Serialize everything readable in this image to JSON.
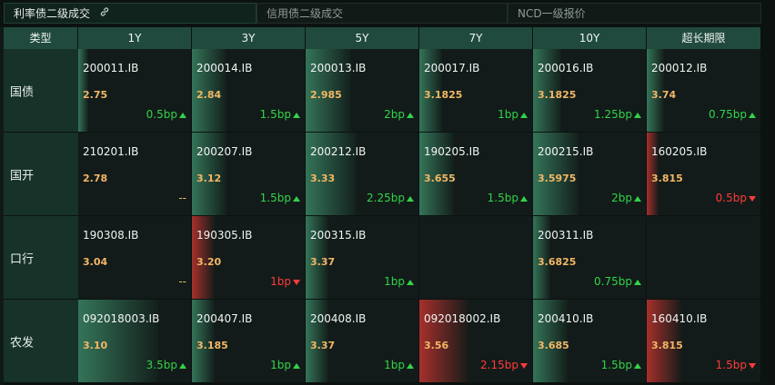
{
  "tabs": [
    {
      "label": "利率债二级成交",
      "active": true,
      "icon": "link-icon"
    },
    {
      "label": "信用债二级成交",
      "active": false
    },
    {
      "label": "NCD一级报价",
      "active": false
    }
  ],
  "table": {
    "columns": [
      "类型",
      "1Y",
      "3Y",
      "5Y",
      "7Y",
      "10Y",
      "超长期限"
    ],
    "rows": [
      {
        "label": "国债",
        "cells": [
          {
            "code": "200011.IB",
            "yield": "2.75",
            "change": "0.5bp",
            "dir": "up",
            "bar_level": 0.09
          },
          {
            "code": "200014.IB",
            "yield": "2.84",
            "change": "1.5bp",
            "dir": "up",
            "bar_level": 0.3
          },
          {
            "code": "200013.IB",
            "yield": "2.985",
            "change": "2bp",
            "dir": "up",
            "bar_level": 0.4
          },
          {
            "code": "200017.IB",
            "yield": "3.1825",
            "change": "1bp",
            "dir": "up",
            "bar_level": 0.2
          },
          {
            "code": "200016.IB",
            "yield": "3.1825",
            "change": "1.25bp",
            "dir": "up",
            "bar_level": 0.25
          },
          {
            "code": "200012.IB",
            "yield": "3.74",
            "change": "0.75bp",
            "dir": "up",
            "bar_level": 0.15
          }
        ]
      },
      {
        "label": "国开",
        "cells": [
          {
            "code": "210201.IB",
            "yield": "2.78",
            "change": "--",
            "dir": "flat",
            "bar_level": 0
          },
          {
            "code": "200207.IB",
            "yield": "3.12",
            "change": "1.5bp",
            "dir": "up",
            "bar_level": 0.3
          },
          {
            "code": "200212.IB",
            "yield": "3.33",
            "change": "2.25bp",
            "dir": "up",
            "bar_level": 0.45
          },
          {
            "code": "190205.IB",
            "yield": "3.655",
            "change": "1.5bp",
            "dir": "up",
            "bar_level": 0.3
          },
          {
            "code": "200215.IB",
            "yield": "3.5975",
            "change": "2bp",
            "dir": "up",
            "bar_level": 0.4
          },
          {
            "code": "160205.IB",
            "yield": "3.815",
            "change": "0.5bp",
            "dir": "down",
            "bar_level": 0.1
          }
        ]
      },
      {
        "label": "口行",
        "cells": [
          {
            "code": "190308.IB",
            "yield": "3.04",
            "change": "--",
            "dir": "flat",
            "bar_level": 0
          },
          {
            "code": "190305.IB",
            "yield": "3.20",
            "change": "1bp",
            "dir": "down",
            "bar_level": 0.2
          },
          {
            "code": "200315.IB",
            "yield": "3.37",
            "change": "1bp",
            "dir": "up",
            "bar_level": 0.2
          },
          {
            "code": "",
            "yield": "",
            "change": "",
            "dir": "none",
            "bar_level": 0
          },
          {
            "code": "200311.IB",
            "yield": "3.6825",
            "change": "0.75bp",
            "dir": "up",
            "bar_level": 0.15
          },
          {
            "code": "",
            "yield": "",
            "change": "",
            "dir": "none",
            "bar_level": 0
          }
        ]
      },
      {
        "label": "农发",
        "cells": [
          {
            "code": "092018003.IB",
            "yield": "3.10",
            "change": "3.5bp",
            "dir": "up",
            "bar_level": 0.7
          },
          {
            "code": "200407.IB",
            "yield": "3.185",
            "change": "1bp",
            "dir": "up",
            "bar_level": 0.2
          },
          {
            "code": "200408.IB",
            "yield": "3.37",
            "change": "1bp",
            "dir": "up",
            "bar_level": 0.2
          },
          {
            "code": "092018002.IB",
            "yield": "3.56",
            "change": "2.15bp",
            "dir": "down",
            "bar_level": 0.43
          },
          {
            "code": "200410.IB",
            "yield": "3.685",
            "change": "1.5bp",
            "dir": "up",
            "bar_level": 0.3
          },
          {
            "code": "160410.IB",
            "yield": "3.815",
            "change": "1.5bp",
            "dir": "down",
            "bar_level": 0.3
          }
        ]
      }
    ]
  },
  "colors": {
    "up": "#33d34a",
    "down": "#ff3b3b",
    "yield": "#f3b765",
    "header": "#214a3e"
  }
}
